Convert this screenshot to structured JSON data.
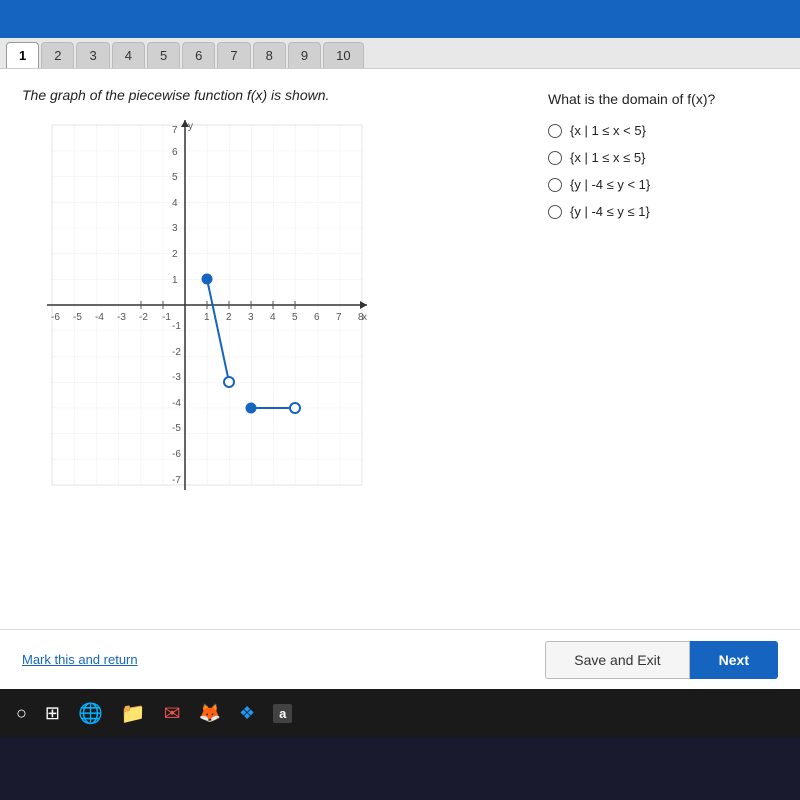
{
  "topBar": {},
  "tabs": {
    "items": [
      {
        "label": "1",
        "active": true
      },
      {
        "label": "2",
        "active": false
      },
      {
        "label": "3",
        "active": false
      },
      {
        "label": "4",
        "active": false
      },
      {
        "label": "5",
        "active": false
      },
      {
        "label": "6",
        "active": false
      },
      {
        "label": "7",
        "active": false
      },
      {
        "label": "8",
        "active": false
      },
      {
        "label": "9",
        "active": false
      },
      {
        "label": "10",
        "active": false
      }
    ]
  },
  "question": {
    "description": "The graph of the piecewise function f(x) is shown.",
    "domainQuestion": "What is the domain of f(x)?",
    "options": [
      {
        "label": "{x | 1 ≤ x < 5}"
      },
      {
        "label": "{x | 1 ≤ x ≤ 5}"
      },
      {
        "label": "{y | -4 ≤ y < 1}"
      },
      {
        "label": "{y | -4 ≤ y ≤ 1}"
      }
    ]
  },
  "footer": {
    "markReturn": "Mark this and return",
    "saveExit": "Save and Exit",
    "next": "Next"
  },
  "graph": {
    "xMin": -6,
    "xMax": 8,
    "yMin": -7,
    "yMax": 7
  }
}
